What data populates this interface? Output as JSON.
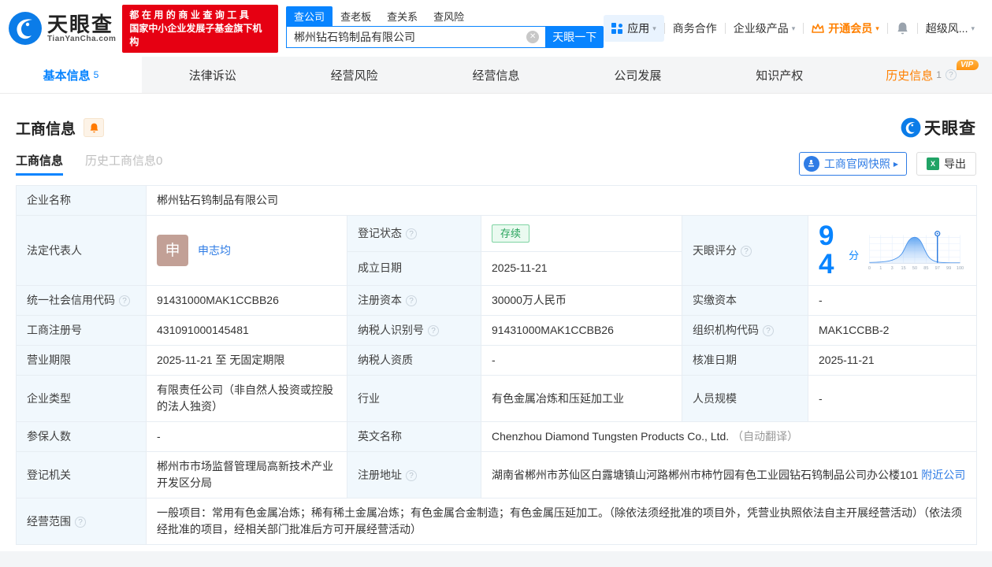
{
  "icons": {
    "help": "?",
    "clear": "✕",
    "caret": "▾",
    "arrow_right": "▶",
    "xls": "X"
  },
  "header": {
    "logo": {
      "name": "天眼查",
      "domain": "TianYanCha.com"
    },
    "slogan_line1": "都在用的商业查询工具",
    "slogan_line2": "国家中小企业发展子基金旗下机构",
    "search": {
      "tabs": [
        {
          "label": "查公司"
        },
        {
          "label": "查老板"
        },
        {
          "label": "查关系"
        },
        {
          "label": "查风险"
        }
      ],
      "value": "郴州钻石钨制品有限公司",
      "button": "天眼一下"
    },
    "nav": {
      "apps": "应用",
      "cooperation": "商务合作",
      "enterprise": "企业级产品",
      "vip": "开通会员",
      "risk": "超级风..."
    }
  },
  "tabs": [
    {
      "label": "基本信息",
      "count": "5"
    },
    {
      "label": "法律诉讼",
      "count": ""
    },
    {
      "label": "经营风险",
      "count": ""
    },
    {
      "label": "经营信息",
      "count": ""
    },
    {
      "label": "公司发展",
      "count": ""
    },
    {
      "label": "知识产权",
      "count": ""
    },
    {
      "label": "历史信息",
      "count": "1",
      "vip": "VIP"
    }
  ],
  "section": {
    "title": "工商信息",
    "watermark": "天眼查",
    "subtabs": [
      {
        "label": "工商信息"
      },
      {
        "label": "历史工商信息0"
      }
    ],
    "actions": {
      "snapshot": "工商官网快照",
      "export": "导出"
    }
  },
  "fields": {
    "company_name": {
      "label": "企业名称",
      "value": "郴州钻石钨制品有限公司"
    },
    "legal_rep": {
      "label": "法定代表人",
      "avatar_char": "申",
      "value": "申志均"
    },
    "reg_status": {
      "label": "登记状态",
      "value": "存续"
    },
    "tyc_score": {
      "label": "天眼评分",
      "value": "94",
      "unit": "分"
    },
    "establish_date": {
      "label": "成立日期",
      "value": "2025-11-21"
    },
    "credit_code": {
      "label": "统一社会信用代码",
      "value": "91431000MAK1CCBB26"
    },
    "reg_capital": {
      "label": "注册资本",
      "value": "30000万人民币"
    },
    "paid_capital": {
      "label": "实缴资本",
      "value": "-"
    },
    "reg_number": {
      "label": "工商注册号",
      "value": "431091000145481"
    },
    "taxpayer_id": {
      "label": "纳税人识别号",
      "value": "91431000MAK1CCBB26"
    },
    "org_code": {
      "label": "组织机构代码",
      "value": "MAK1CCBB-2"
    },
    "business_term": {
      "label": "营业期限",
      "value": "2025-11-21 至 无固定期限"
    },
    "taxpayer_quality": {
      "label": "纳税人资质",
      "value": "-"
    },
    "approval_date": {
      "label": "核准日期",
      "value": "2025-11-21"
    },
    "company_type": {
      "label": "企业类型",
      "value": "有限责任公司（非自然人投资或控股的法人独资）"
    },
    "industry": {
      "label": "行业",
      "value": "有色金属冶炼和压延加工业"
    },
    "staff_size": {
      "label": "人员规模",
      "value": "-"
    },
    "insured_count": {
      "label": "参保人数",
      "value": "-"
    },
    "english_name": {
      "label": "英文名称",
      "value": "Chenzhou Diamond Tungsten Products Co., Ltd.",
      "note": "（自动翻译）"
    },
    "reg_authority": {
      "label": "登记机关",
      "value": "郴州市市场监督管理局高新技术产业开发区分局"
    },
    "reg_address": {
      "label": "注册地址",
      "value": "湖南省郴州市苏仙区白露塘镇山河路郴州市柿竹园有色工业园钻石钨制品公司办公楼101",
      "link": "附近公司"
    },
    "business_scope": {
      "label": "经营范围",
      "value": "一般项目：常用有色金属冶炼；稀有稀土金属冶炼；有色金属合金制造；有色金属压延加工。（除依法须经批准的项目外，凭营业执照依法自主开展经营活动）（依法须经批准的项目，经相关部门批准后方可开展经营活动）"
    }
  },
  "chart_data": {
    "type": "area",
    "title": "天眼评分",
    "score": 94,
    "x_ticks": [
      "0",
      "1",
      "3",
      "15",
      "50",
      "85",
      "97",
      "99",
      "100"
    ],
    "marker_tick": "97",
    "legend_position": "none",
    "description": "bell-curve score distribution, vertical marker pin near the 97 tick"
  }
}
